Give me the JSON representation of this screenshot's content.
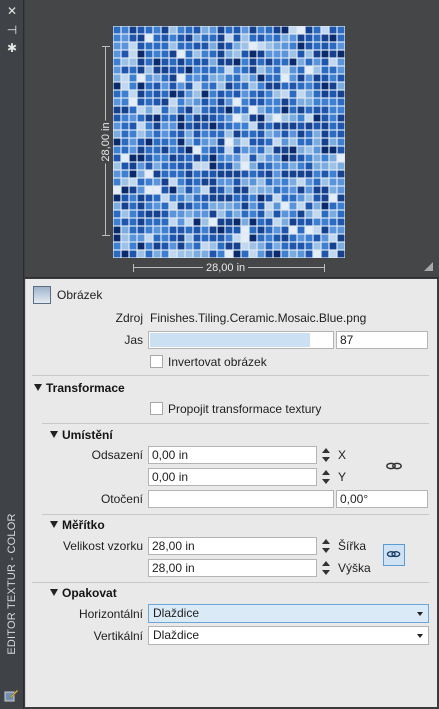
{
  "palette": {
    "mosaic_colors": [
      "#0b2a6b",
      "#16418f",
      "#1f56ad",
      "#2c6bc2",
      "#3d7fd0",
      "#5a95db",
      "#7aacdf",
      "#9ec2e6",
      "#c2d8ee",
      "#e4eef8"
    ]
  },
  "window": {
    "vertical_title": "EDITOR TEXTUR - COLOR",
    "close_icon_glyph": "✕",
    "pin_icon_glyph": "⊣",
    "settings_icon_glyph": "✱"
  },
  "preview": {
    "width_label": "28,00 in",
    "height_label": "28,00 in"
  },
  "image_section": {
    "title": "Obrázek",
    "source_label": "Zdroj",
    "source_value": "Finishes.Tiling.Ceramic.Mosaic.Blue.png",
    "brightness_label": "Jas",
    "brightness_value": "87",
    "brightness_fraction": 0.87,
    "invert_label": "Invertovat obrázek",
    "invert_checked": false
  },
  "transform_section": {
    "title": "Transformace",
    "link_label": "Propojit transformace textury",
    "link_checked": false
  },
  "position_section": {
    "title": "Umístění",
    "offset_label": "Odsazení",
    "offset_x": "0,00 in",
    "offset_y": "0,00 in",
    "x_axis": "X",
    "y_axis": "Y",
    "rotation_label": "Otočení",
    "rotation_value": "0,00°"
  },
  "scale_section": {
    "title": "Měřítko",
    "sample_size_label": "Velikost vzorku",
    "width_value": "28,00 in",
    "height_value": "28,00 in",
    "width_axis": "Šířka",
    "height_axis": "Výška"
  },
  "repeat_section": {
    "title": "Opakovat",
    "horizontal_label": "Horizontální",
    "horizontal_value": "Dlaždice",
    "vertical_label": "Vertikální",
    "vertical_value": "Dlaždice"
  }
}
